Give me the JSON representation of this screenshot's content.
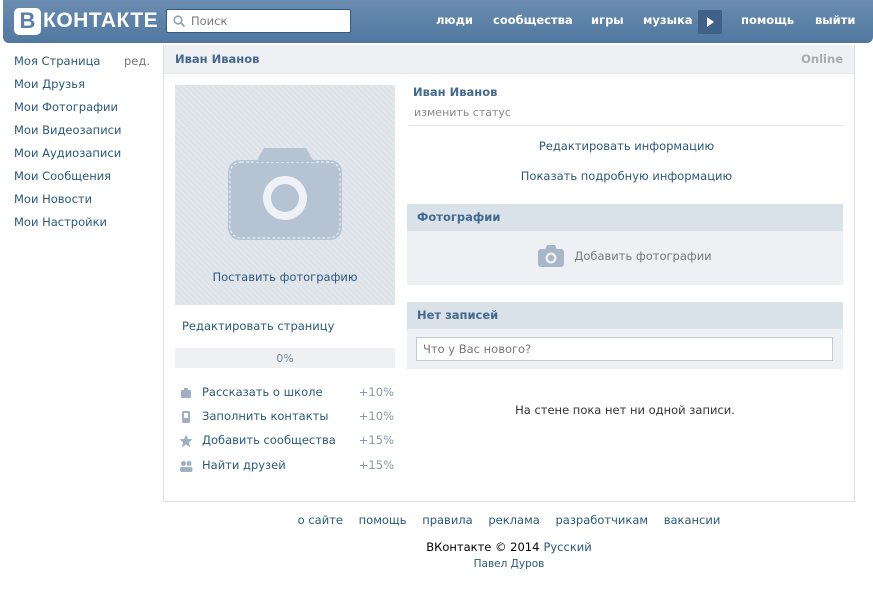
{
  "header": {
    "logo_letter": "В",
    "logo_text": "КОНТАКТЕ",
    "search_placeholder": "Поиск",
    "nav": [
      {
        "id": "people",
        "label": "люди"
      },
      {
        "id": "communities",
        "label": "сообщества"
      },
      {
        "id": "games",
        "label": "игры"
      },
      {
        "id": "music",
        "label": "музыка"
      },
      {
        "id": "help",
        "label": "помощь"
      },
      {
        "id": "logout",
        "label": "выйти"
      }
    ]
  },
  "sidebar": {
    "edit_label": "ред.",
    "items": [
      {
        "label": "Моя Страница"
      },
      {
        "label": "Мои Друзья"
      },
      {
        "label": "Мои Фотографии"
      },
      {
        "label": "Мои Видеозаписи"
      },
      {
        "label": "Мои Аудиозаписи"
      },
      {
        "label": "Мои Сообщения"
      },
      {
        "label": "Мои Новости"
      },
      {
        "label": "Мои Настройки"
      }
    ]
  },
  "profile": {
    "header_name": "Иван Иванов",
    "online": "Online",
    "set_photo": "Поставить фотографию",
    "edit_page": "Редактировать страницу",
    "progress_label": "0%",
    "progress_fraction": 0,
    "tasks": [
      {
        "label": "Рассказать о школе",
        "pct": "+10%",
        "icon": "school-icon"
      },
      {
        "label": "Заполнить контакты",
        "pct": "+10%",
        "icon": "phone-icon"
      },
      {
        "label": "Добавить сообщества",
        "pct": "+15%",
        "icon": "star-icon"
      },
      {
        "label": "Найти друзей",
        "pct": "+15%",
        "icon": "friends-icon"
      }
    ],
    "name": "Иван Иванов",
    "status": "изменить статус",
    "edit_info": "Редактировать информацию",
    "show_info": "Показать подробную информацию"
  },
  "photos": {
    "title": "Фотографии",
    "add_label": "Добавить фотографии"
  },
  "wall": {
    "title": "Нет записей",
    "input_placeholder": "Что у Вас нового?",
    "empty": "На стене пока нет ни одной записи."
  },
  "footer": {
    "links": [
      "о сайте",
      "помощь",
      "правила",
      "реклама",
      "разработчикам",
      "вакансии"
    ],
    "copyright": "ВКонтакте © 2014",
    "language": "Русский",
    "author": "Павел Дуров"
  },
  "colors": {
    "header_bg": "#5b7fa6",
    "link": "#2b587a",
    "section_head": "#dae2e9"
  }
}
